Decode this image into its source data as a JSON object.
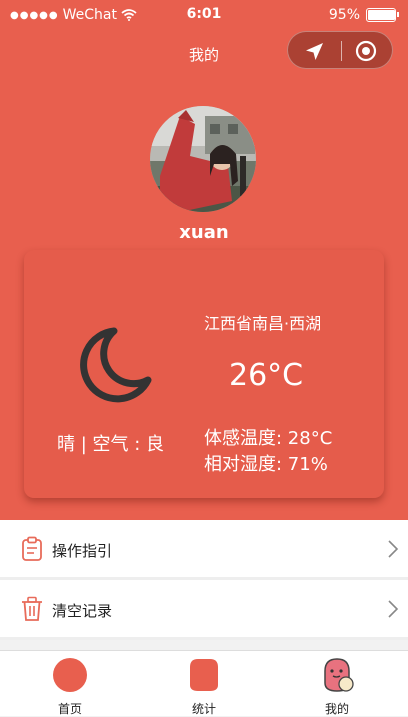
{
  "status_bar": {
    "carrier": "WeChat",
    "time": "6:01",
    "battery": "95%",
    "battery_level": 0.95
  },
  "nav": {
    "title": "我的",
    "location_icon": "navigation-arrow-icon",
    "target_icon": "target-icon"
  },
  "profile": {
    "username": "xuan"
  },
  "weather": {
    "icon": "moon-icon",
    "condition": "晴 | 空气 : 良",
    "location": "江西省南昌·西湖",
    "temperature": "26°C",
    "feels_like": "体感温度: 28°C",
    "humidity": "相对湿度: 71%"
  },
  "menu": [
    {
      "label": "操作指引",
      "icon": "clipboard-icon"
    },
    {
      "label": "清空记录",
      "icon": "trash-icon"
    }
  ],
  "tabs": [
    {
      "label": "首页",
      "icon": "home-icon"
    },
    {
      "label": "统计",
      "icon": "stats-icon"
    },
    {
      "label": "我的",
      "icon": "profile-icon"
    }
  ],
  "colors": {
    "accent": "#e85f4e",
    "card": "#e55c4b"
  }
}
